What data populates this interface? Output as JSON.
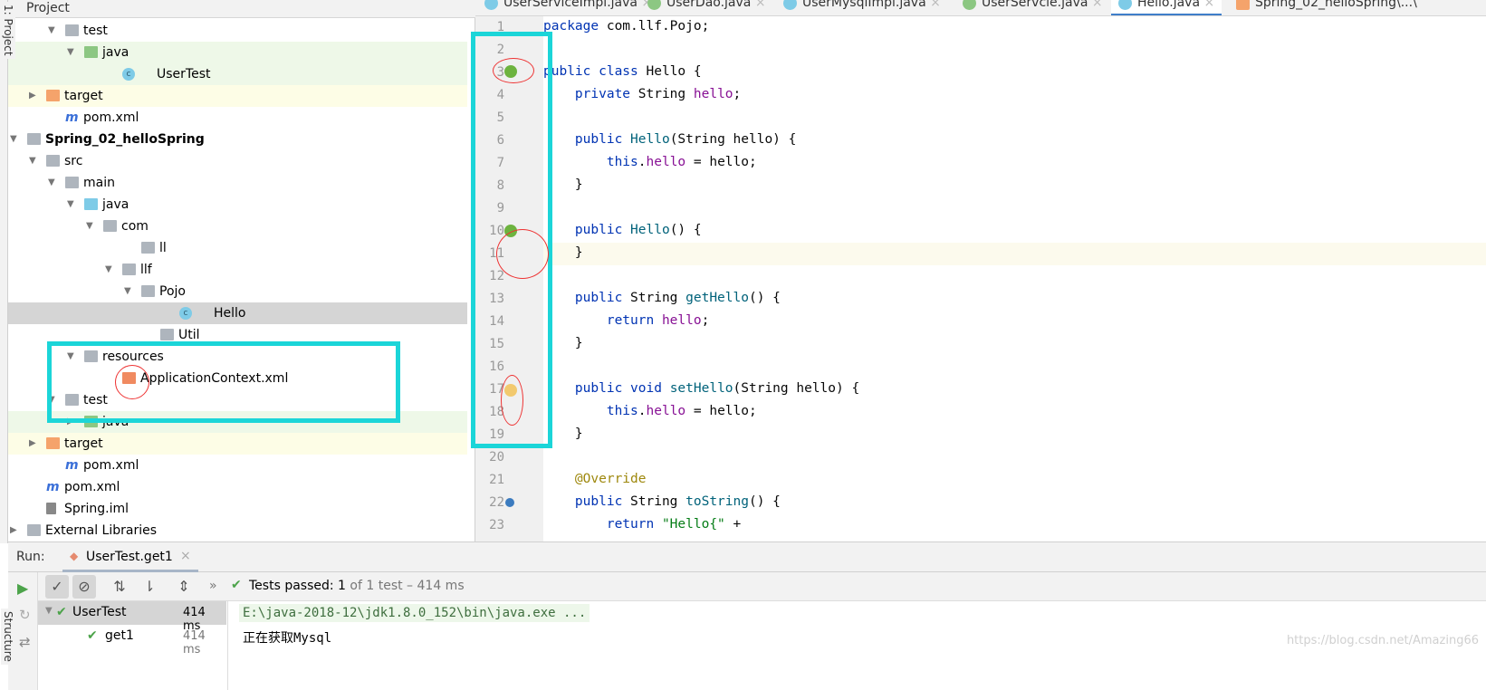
{
  "project_panel": {
    "title": "Project",
    "tree": [
      {
        "label": "test",
        "icon": "folder",
        "depth": 3,
        "expanded": true
      },
      {
        "label": "java",
        "icon": "test-source-folder",
        "depth": 4,
        "expanded": true,
        "bg": "#eef8e8"
      },
      {
        "label": "UserTest",
        "icon": "test-class",
        "depth": 6,
        "bg": "#eef8e8"
      },
      {
        "label": "target",
        "icon": "excluded-folder",
        "depth": 2,
        "expanded": false,
        "bg": "#fdfde6"
      },
      {
        "label": "pom.xml",
        "icon": "maven",
        "depth": 3
      },
      {
        "label": "Spring_02_helloSpring",
        "icon": "module",
        "depth": 1,
        "expanded": true,
        "bold": true
      },
      {
        "label": "src",
        "icon": "folder",
        "depth": 2,
        "expanded": true
      },
      {
        "label": "main",
        "icon": "folder",
        "depth": 3,
        "expanded": true
      },
      {
        "label": "java",
        "icon": "source-folder",
        "depth": 4,
        "expanded": true
      },
      {
        "label": "com",
        "icon": "package",
        "depth": 5,
        "expanded": true
      },
      {
        "label": "ll",
        "icon": "package",
        "depth": 7
      },
      {
        "label": "llf",
        "icon": "package",
        "depth": 6,
        "expanded": true
      },
      {
        "label": "Pojo",
        "icon": "package",
        "depth": 7,
        "expanded": true
      },
      {
        "label": "Hello",
        "icon": "class",
        "depth": 9,
        "selected": true
      },
      {
        "label": "Util",
        "icon": "package",
        "depth": 8
      },
      {
        "label": "resources",
        "icon": "resources-folder",
        "depth": 4,
        "expanded": true
      },
      {
        "label": "ApplicationContext.xml",
        "icon": "spring-xml",
        "depth": 6
      },
      {
        "label": "test",
        "icon": "folder",
        "depth": 3,
        "expanded": true
      },
      {
        "label": "java",
        "icon": "test-source-folder",
        "depth": 4,
        "expanded": false,
        "bg": "#eef8e8"
      },
      {
        "label": "target",
        "icon": "excluded-folder",
        "depth": 2,
        "expanded": false,
        "bg": "#fdfde6"
      },
      {
        "label": "pom.xml",
        "icon": "maven",
        "depth": 3
      },
      {
        "label": "pom.xml",
        "icon": "maven",
        "depth": 2
      },
      {
        "label": "Spring.iml",
        "icon": "iml-file",
        "depth": 2
      },
      {
        "label": "External Libraries",
        "icon": "library",
        "depth": 1,
        "expanded": false
      }
    ]
  },
  "tabs": [
    {
      "label": "UserServiceImpl.java",
      "icon": "class",
      "color": "#7ecbe7"
    },
    {
      "label": "UserDao.java",
      "icon": "interface",
      "color": "#8cc782"
    },
    {
      "label": "UserMysqlImpl.java",
      "icon": "class",
      "color": "#7ecbe7"
    },
    {
      "label": "UserServcie.java",
      "icon": "interface",
      "color": "#8cc782"
    },
    {
      "label": "Hello.java",
      "icon": "class",
      "color": "#7ecbe7",
      "active": true
    },
    {
      "label": "Spring_02_helloSpring\\...\\",
      "icon": "spring-xml",
      "color": "#f5a36b"
    }
  ],
  "editor": {
    "lines": [
      [
        [
          "kw",
          "package "
        ],
        [
          "tx",
          "com.llf.Pojo;"
        ]
      ],
      [],
      [
        [
          "kw",
          "public class "
        ],
        [
          "tx",
          "Hello {"
        ]
      ],
      [
        [
          "kw",
          "    private "
        ],
        [
          "tx",
          "String "
        ],
        [
          "fd",
          "hello"
        ],
        [
          "tx",
          ";"
        ]
      ],
      [],
      [
        [
          "kw",
          "    public "
        ],
        [
          "fn",
          "Hello"
        ],
        [
          "tx",
          "(String hello) {"
        ]
      ],
      [
        [
          "kw",
          "        this"
        ],
        [
          "tx",
          "."
        ],
        [
          "fd",
          "hello"
        ],
        [
          "tx",
          " = hello;"
        ]
      ],
      [
        [
          "tx",
          "    }"
        ]
      ],
      [],
      [
        [
          "kw",
          "    public "
        ],
        [
          "fn",
          "Hello"
        ],
        [
          "tx",
          "() {"
        ]
      ],
      [
        [
          "tx",
          "    }"
        ]
      ],
      [],
      [
        [
          "kw",
          "    public "
        ],
        [
          "tx",
          "String "
        ],
        [
          "fn",
          "getHello"
        ],
        [
          "tx",
          "() {"
        ]
      ],
      [
        [
          "kw",
          "        return "
        ],
        [
          "fd",
          "hello"
        ],
        [
          "tx",
          ";"
        ]
      ],
      [
        [
          "tx",
          "    }"
        ]
      ],
      [],
      [
        [
          "kw",
          "    public void "
        ],
        [
          "fn",
          "setHello"
        ],
        [
          "tx",
          "(String hello) {"
        ]
      ],
      [
        [
          "kw",
          "        this"
        ],
        [
          "tx",
          "."
        ],
        [
          "fd",
          "hello"
        ],
        [
          "tx",
          " = hello;"
        ]
      ],
      [
        [
          "tx",
          "    }"
        ]
      ],
      [],
      [
        [
          "an",
          "    @Override"
        ]
      ],
      [
        [
          "kw",
          "    public "
        ],
        [
          "tx",
          "String "
        ],
        [
          "fn",
          "toString"
        ],
        [
          "tx",
          "() {"
        ]
      ],
      [
        [
          "kw",
          "        return "
        ],
        [
          "st",
          "\"Hello{\""
        ],
        [
          "tx",
          " +"
        ]
      ]
    ]
  },
  "run": {
    "label": "Run:",
    "tab": "UserTest.get1",
    "status_prefix": "Tests passed:",
    "status_count": "1",
    "status_suffix": "of 1 test – 414 ms",
    "tree": [
      {
        "label": "UserTest",
        "time": "414 ms"
      },
      {
        "label": "get1",
        "time": "414 ms"
      }
    ],
    "console": [
      "E:\\java-2018-12\\jdk1.8.0_152\\bin\\java.exe ...",
      "正在获取Mysql"
    ]
  },
  "side_labels": {
    "left_top": "1: Project",
    "left_bottom": "Structure"
  },
  "watermark": "https://blog.csdn.net/Amazing66"
}
